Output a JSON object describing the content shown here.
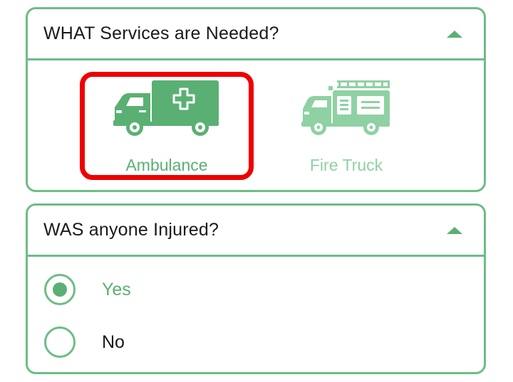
{
  "colors": {
    "accent": "#5ab073",
    "border": "#6dbd85",
    "selection_highlight": "#ee0000",
    "text_dark": "#1a1a1a",
    "text_selected_green": "#5ab073",
    "text_unselected_green": "#8fd1a3"
  },
  "services_section": {
    "title": "WHAT Services are Needed?",
    "toggle_icon": "caret-up-icon",
    "options": [
      {
        "label": "Ambulance",
        "icon": "ambulance-icon",
        "selected": true
      },
      {
        "label": "Fire Truck",
        "icon": "fire-truck-icon",
        "selected": false
      }
    ]
  },
  "injured_section": {
    "title": "WAS anyone Injured?",
    "toggle_icon": "caret-up-icon",
    "options": [
      {
        "label": "Yes",
        "checked": true
      },
      {
        "label": "No",
        "checked": false
      }
    ]
  }
}
